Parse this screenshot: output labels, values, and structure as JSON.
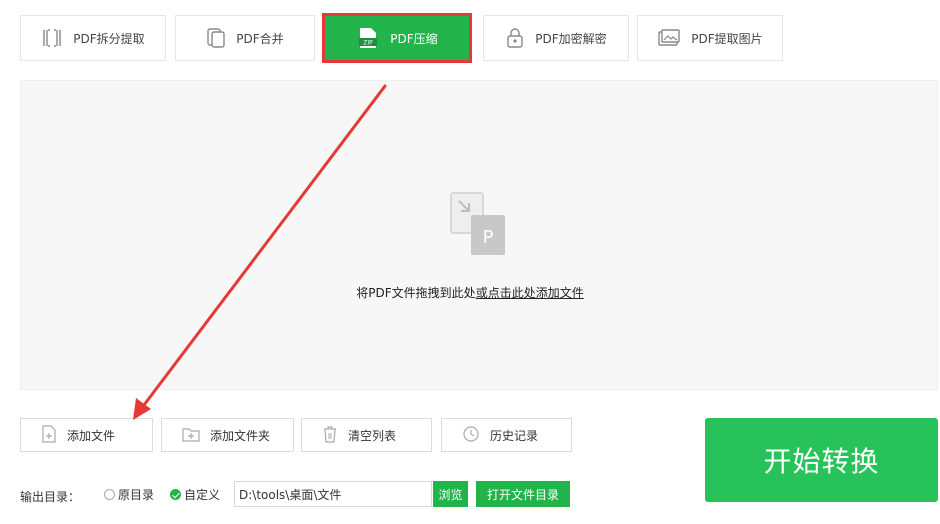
{
  "tabs": [
    {
      "label": "PDF拆分提取",
      "icon": "split-icon"
    },
    {
      "label": "PDF合并",
      "icon": "merge-icon"
    },
    {
      "label": "PDF压缩",
      "icon": "zip-icon",
      "active": true
    },
    {
      "label": "PDF加密解密",
      "icon": "lock-icon"
    },
    {
      "label": "PDF提取图片",
      "icon": "image-icon"
    }
  ],
  "dropzone": {
    "text_prefix": "将PDF文件拖拽到此处",
    "text_link": "或点击此处添加文件",
    "icon": "pdf-file-icon",
    "icon_letter": "P"
  },
  "toolbar": {
    "add_file": "添加文件",
    "add_folder": "添加文件夹",
    "clear_list": "清空列表",
    "history": "历史记录"
  },
  "start_button": "开始转换",
  "output": {
    "label": "输出目录：",
    "option_original": "原目录",
    "option_custom": "自定义",
    "selected": "自定义",
    "path": "D:\\tools\\桌面\\文件",
    "browse": "浏览",
    "open_dir": "打开文件目录"
  },
  "zip_badge": "ZIP",
  "colors": {
    "accent": "#22b44a",
    "start_button": "#27c25a",
    "highlight_border": "#e53935",
    "arrow": "#e53935",
    "dropzone_bg": "#f7f7f7"
  }
}
